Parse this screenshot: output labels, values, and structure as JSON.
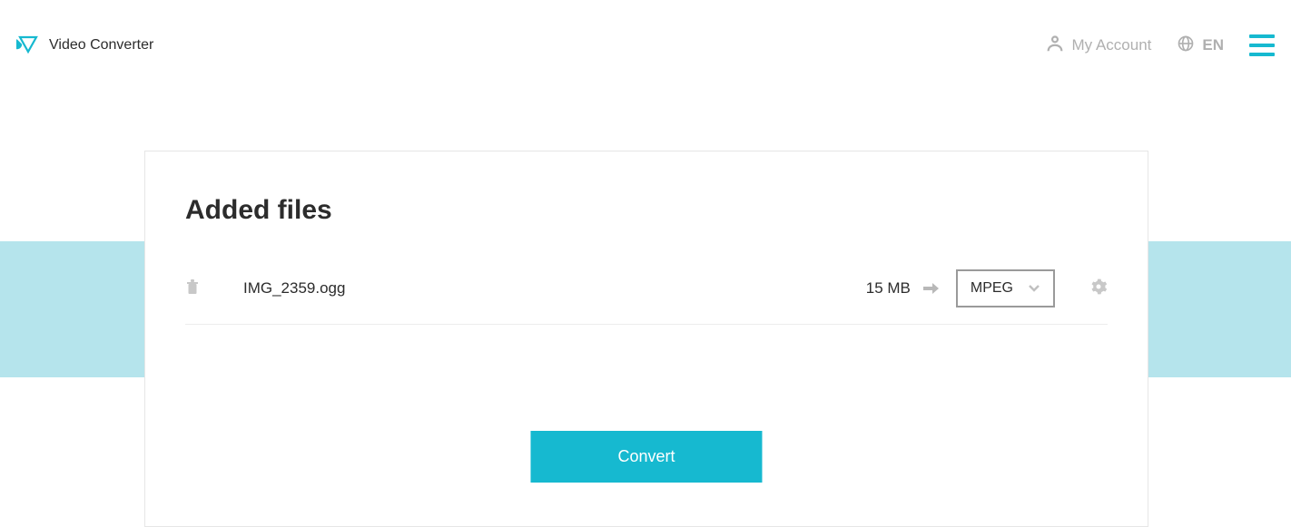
{
  "header": {
    "app_title": "Video Converter",
    "account_label": "My Account",
    "lang_label": "EN"
  },
  "card": {
    "title": "Added files",
    "convert_label": "Convert"
  },
  "file": {
    "name": "IMG_2359.ogg",
    "size": "15 MB",
    "format": "MPEG"
  },
  "colors": {
    "accent": "#16b9d0",
    "band": "#b5e4ec"
  }
}
